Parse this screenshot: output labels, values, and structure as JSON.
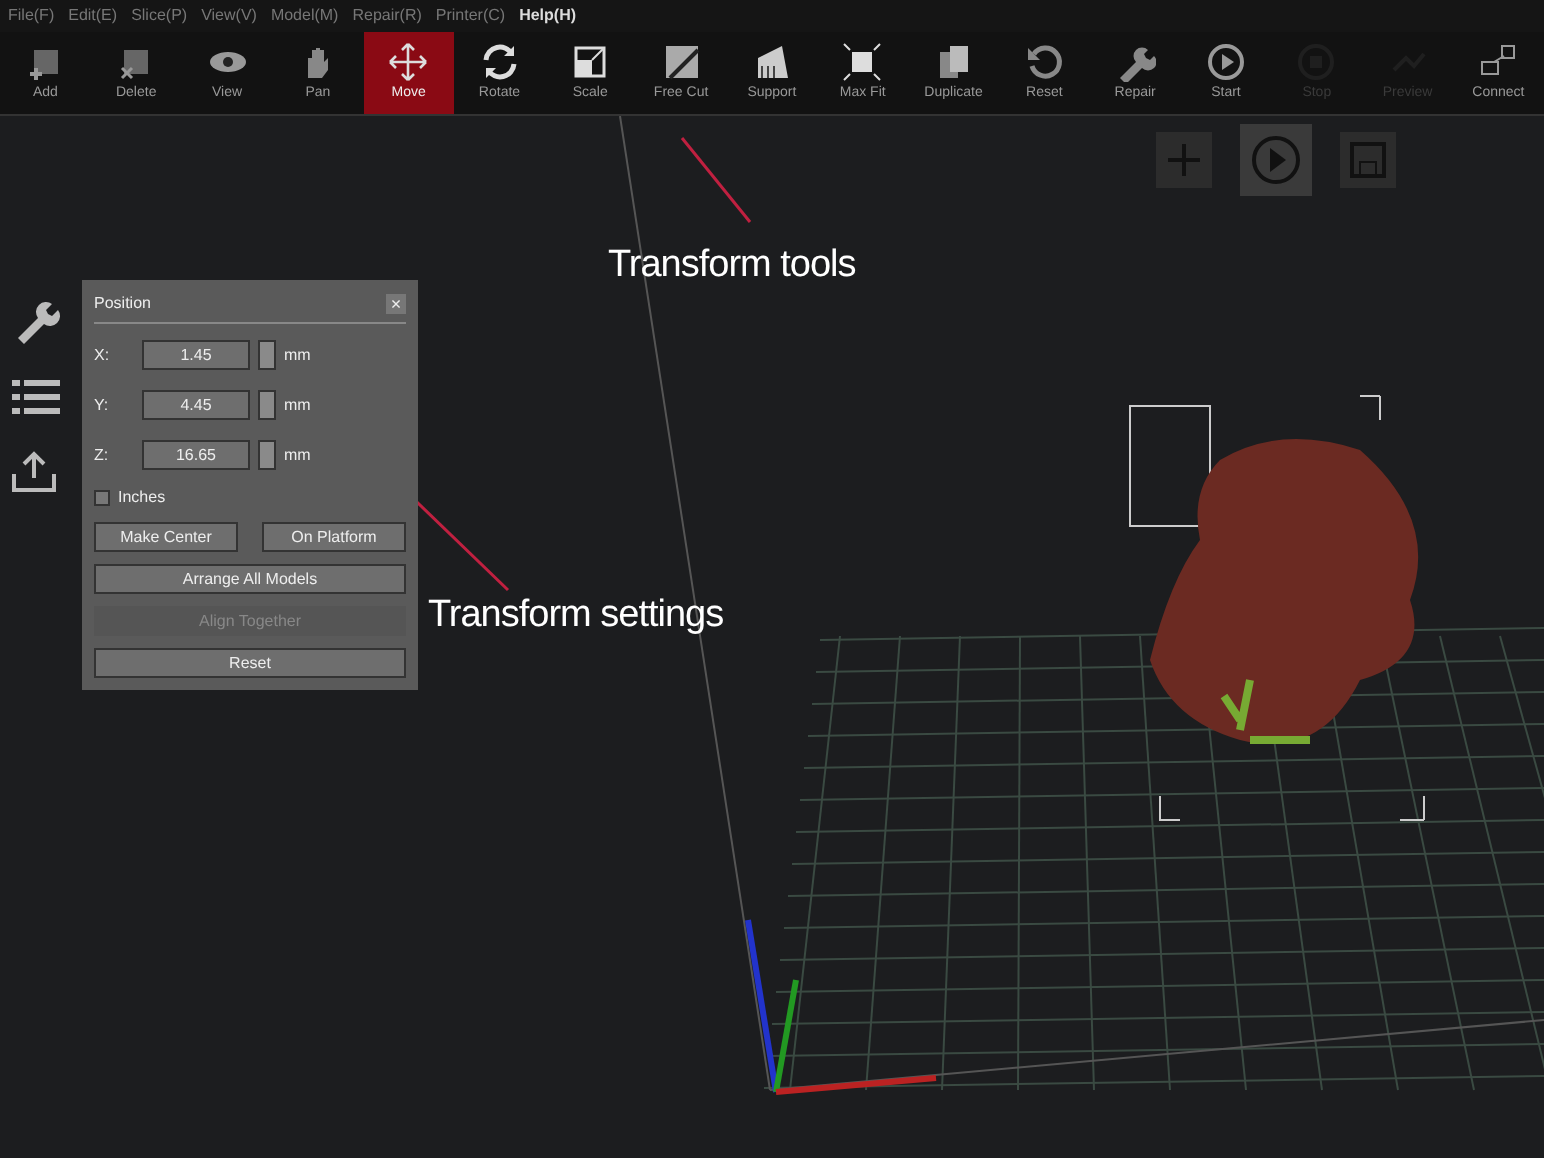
{
  "menu": [
    {
      "label": "File(F)",
      "highlighted": false
    },
    {
      "label": "Edit(E)",
      "highlighted": false
    },
    {
      "label": "Slice(P)",
      "highlighted": false
    },
    {
      "label": "View(V)",
      "highlighted": false
    },
    {
      "label": "Model(M)",
      "highlighted": false
    },
    {
      "label": "Repair(R)",
      "highlighted": false
    },
    {
      "label": "Printer(C)",
      "highlighted": false
    },
    {
      "label": "Help(H)",
      "highlighted": true
    }
  ],
  "toolbar": [
    {
      "label": "Add",
      "kind": "add",
      "selected": false,
      "disabled": false
    },
    {
      "label": "Delete",
      "kind": "delete",
      "selected": false,
      "disabled": false
    },
    {
      "label": "View",
      "kind": "view",
      "selected": false,
      "disabled": false
    },
    {
      "label": "Pan",
      "kind": "pan",
      "selected": false,
      "disabled": false
    },
    {
      "label": "Move",
      "kind": "move",
      "selected": true,
      "disabled": false
    },
    {
      "label": "Rotate",
      "kind": "rotate",
      "selected": false,
      "disabled": false
    },
    {
      "label": "Scale",
      "kind": "scale",
      "selected": false,
      "disabled": false
    },
    {
      "label": "Free Cut",
      "kind": "cut",
      "selected": false,
      "disabled": false
    },
    {
      "label": "Support",
      "kind": "support",
      "selected": false,
      "disabled": false
    },
    {
      "label": "Max Fit",
      "kind": "maxfit",
      "selected": false,
      "disabled": false
    },
    {
      "label": "Duplicate",
      "kind": "duplicate",
      "selected": false,
      "disabled": false
    },
    {
      "label": "Reset",
      "kind": "reset",
      "selected": false,
      "disabled": false
    },
    {
      "label": "Repair",
      "kind": "repair",
      "selected": false,
      "disabled": false
    },
    {
      "label": "Start",
      "kind": "start",
      "selected": false,
      "disabled": false
    },
    {
      "label": "Stop",
      "kind": "stop",
      "selected": false,
      "disabled": true
    },
    {
      "label": "Preview",
      "kind": "preview",
      "selected": false,
      "disabled": true
    },
    {
      "label": "Connect",
      "kind": "connect",
      "selected": false,
      "disabled": false
    }
  ],
  "annotations": [
    {
      "text": "Transform tools"
    },
    {
      "text": "Transform settings"
    }
  ],
  "panel": {
    "title": "Position",
    "close": "×",
    "fields": [
      {
        "label": "X:",
        "value": "1.45",
        "unit": "mm"
      },
      {
        "label": "Y:",
        "value": "4.45",
        "unit": "mm"
      },
      {
        "label": "Z:",
        "value": "16.65",
        "unit": "mm"
      }
    ],
    "inches": {
      "label": "Inches",
      "checked": false
    },
    "buttons": [
      {
        "label": "Make Center",
        "disabled": false
      },
      {
        "label": "On Platform",
        "disabled": false
      },
      {
        "label": "Arrange All Models",
        "disabled": false
      },
      {
        "label": "Align Together",
        "disabled": true
      },
      {
        "label": "Reset",
        "disabled": false
      }
    ]
  }
}
